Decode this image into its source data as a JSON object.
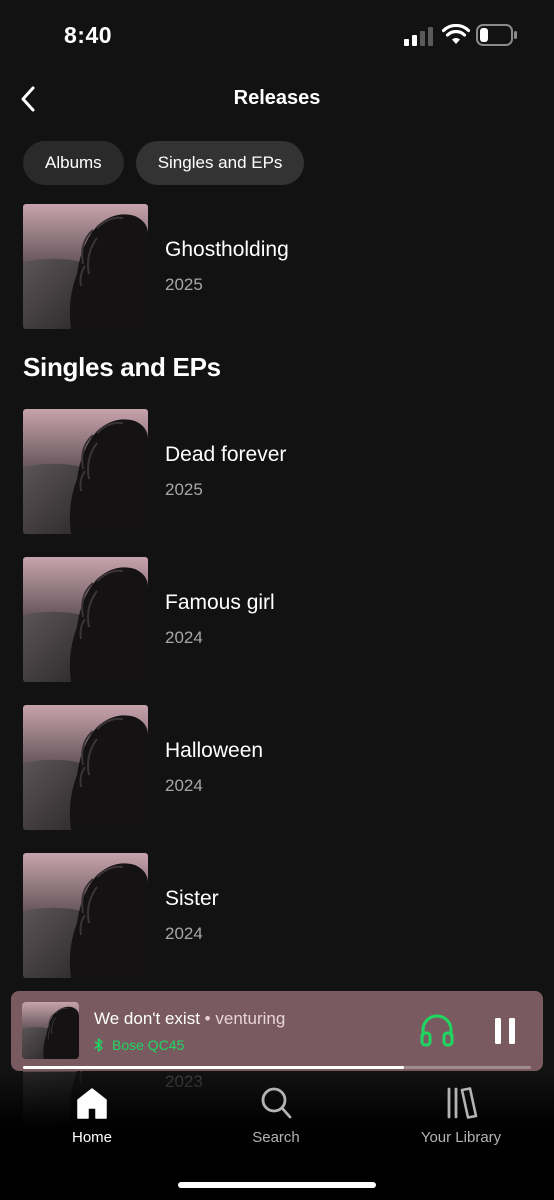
{
  "status_bar": {
    "time": "8:40",
    "signal_icon": "cellular-signal-icon",
    "wifi_icon": "wifi-icon",
    "battery_icon": "battery-low-icon"
  },
  "header": {
    "back_icon": "chevron-left-icon",
    "title": "Releases"
  },
  "filters": [
    {
      "label": "Albums",
      "selected": false
    },
    {
      "label": "Singles and EPs",
      "selected": false
    }
  ],
  "albums": [
    {
      "title": "Ghostholding",
      "year": "2025"
    }
  ],
  "singles_section": {
    "heading": "Singles and EPs",
    "items": [
      {
        "title": "Dead forever",
        "year": "2025"
      },
      {
        "title": "Famous girl",
        "year": "2024"
      },
      {
        "title": "Halloween",
        "year": "2024"
      },
      {
        "title": "Sister",
        "year": "2024"
      },
      {
        "title": "",
        "year": "2023"
      }
    ]
  },
  "now_playing": {
    "track": "We don't exist",
    "separator": "•",
    "artist": "venturing",
    "device": "Bose QC45",
    "device_icon": "bluetooth-icon",
    "connect_icon": "headphones-icon",
    "control_icon": "pause-icon",
    "progress": 0.75,
    "background_color": "#7a5a61",
    "device_color": "#1ed760"
  },
  "bottom_nav": [
    {
      "label": "Home",
      "icon": "home-icon",
      "active": true
    },
    {
      "label": "Search",
      "icon": "search-icon",
      "active": false
    },
    {
      "label": "Your Library",
      "icon": "library-icon",
      "active": false
    }
  ],
  "colors": {
    "background": "#121212",
    "chip": "#2a2a2a",
    "secondary_text": "#a7a7a7",
    "accent": "#1ed760"
  }
}
